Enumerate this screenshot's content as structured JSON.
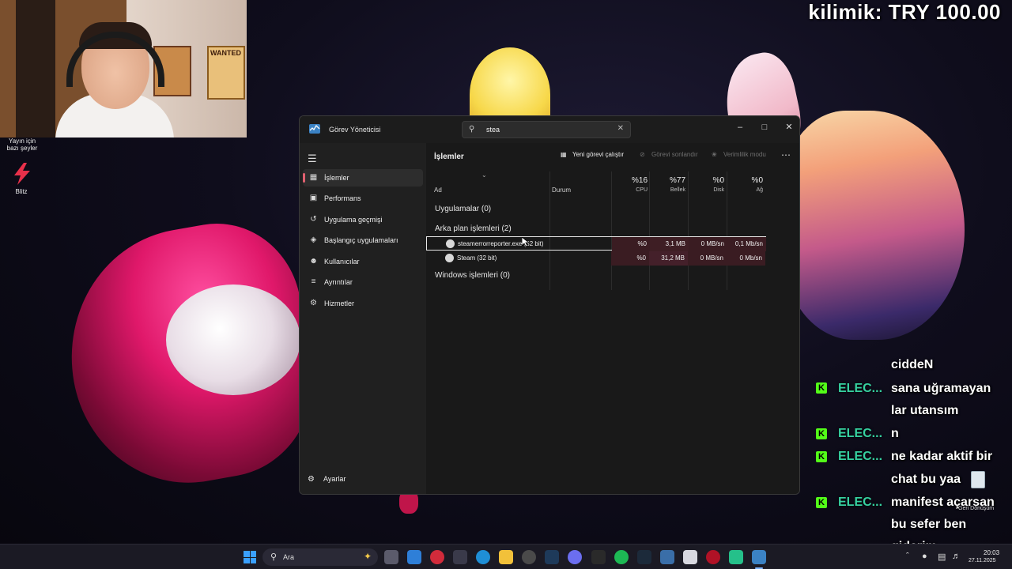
{
  "overlay": {
    "donation": "kilimik: TRY 100.00"
  },
  "desktop": {
    "caption": "Yayın için bazı şeyler",
    "blitz_label": "Blitz",
    "recycle_label": "Geri Dönüşüm"
  },
  "task_manager": {
    "title": "Görev Yöneticisi",
    "search_value": "stea",
    "sidebar": [
      {
        "label": "İşlemler",
        "icon": "processes-icon",
        "active": true
      },
      {
        "label": "Performans",
        "icon": "performance-icon",
        "active": false
      },
      {
        "label": "Uygulama geçmişi",
        "icon": "app-history-icon",
        "active": false
      },
      {
        "label": "Başlangıç uygulamaları",
        "icon": "startup-apps-icon",
        "active": false
      },
      {
        "label": "Kullanıcılar",
        "icon": "users-icon",
        "active": false
      },
      {
        "label": "Ayrıntılar",
        "icon": "details-icon",
        "active": false
      },
      {
        "label": "Hizmetler",
        "icon": "services-icon",
        "active": false
      }
    ],
    "settings_label": "Ayarlar",
    "page_title": "İşlemler",
    "toolbar": {
      "new_task": "Yeni görevi çalıştır",
      "end_task": "Görevi sonlandır",
      "efficiency_mode": "Verimlilik modu"
    },
    "columns": {
      "name": "Ad",
      "status": "Durum",
      "cpu_pct": "%16",
      "cpu": "CPU",
      "memory_pct": "%77",
      "memory": "Bellek",
      "disk_pct": "%0",
      "disk": "Disk",
      "network_pct": "%0",
      "network": "Ağ"
    },
    "groups": {
      "apps": "Uygulamalar (0)",
      "background": "Arka plan işlemleri (2)",
      "windows": "Windows işlemleri (0)"
    },
    "processes": [
      {
        "name": "steamerrorreporter.exe (32 bit)",
        "cpu": "%0",
        "memory": "3,1 MB",
        "disk": "0 MB/sn",
        "network": "0,1 Mb/sn",
        "selected": true
      },
      {
        "name": "Steam (32 bit)",
        "cpu": "%0",
        "memory": "31,2 MB",
        "disk": "0 MB/sn",
        "network": "0 Mb/sn",
        "selected": false
      }
    ]
  },
  "chat": [
    {
      "user": "",
      "text": "ciddeN"
    },
    {
      "user": "ELEC...",
      "text": "sana uğramayan"
    },
    {
      "user": "",
      "text": "lar utansım"
    },
    {
      "user": "ELEC...",
      "text": "n"
    },
    {
      "user": "ELEC...",
      "text": "ne kadar aktif bir"
    },
    {
      "user": "",
      "text": "chat bu yaa"
    },
    {
      "user": "ELEC...",
      "text": "manifest açarsan"
    },
    {
      "user": "",
      "text": "bu sefer ben"
    },
    {
      "user": "",
      "text": "giderim"
    }
  ],
  "taskbar": {
    "search_label": "Ara",
    "time": "20:03",
    "date": "27.11.2025"
  }
}
